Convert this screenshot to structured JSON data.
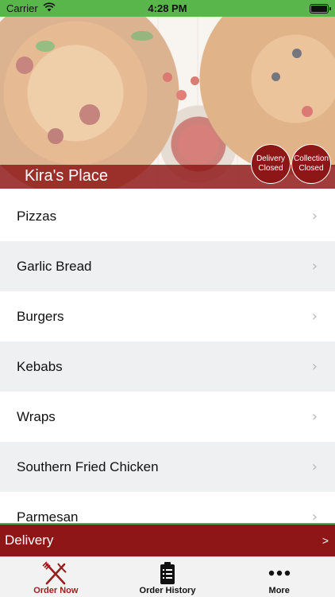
{
  "status_bar": {
    "carrier": "Carrier",
    "time": "4:28 PM",
    "wifi_icon": "wifi-icon",
    "battery_icon": "battery-icon",
    "battery_level": 1.0
  },
  "hero": {
    "restaurant_name": "Kira's Place",
    "delivery_badge": {
      "line1": "Delivery",
      "line2": "Closed"
    },
    "collection_badge": {
      "line1": "Collection",
      "line2": "Closed"
    }
  },
  "menu": {
    "items": [
      {
        "label": "Pizzas"
      },
      {
        "label": "Garlic Bread"
      },
      {
        "label": "Burgers"
      },
      {
        "label": "Kebabs"
      },
      {
        "label": "Wraps"
      },
      {
        "label": "Southern Fried Chicken"
      },
      {
        "label": "Parmesan"
      }
    ],
    "chevron": "›"
  },
  "delivery_bar": {
    "label": "Delivery",
    "arrow": ">"
  },
  "tabs": [
    {
      "label": "Order Now",
      "icon": "fork-knife-icon",
      "active": true
    },
    {
      "label": "Order History",
      "icon": "clipboard-list-icon",
      "active": false
    },
    {
      "label": "More",
      "icon": "more-dots-icon",
      "active": false
    }
  ],
  "colors": {
    "brand": "#8f1616",
    "status_bar": "#59b64a",
    "active_tab": "#9b1c1c"
  }
}
